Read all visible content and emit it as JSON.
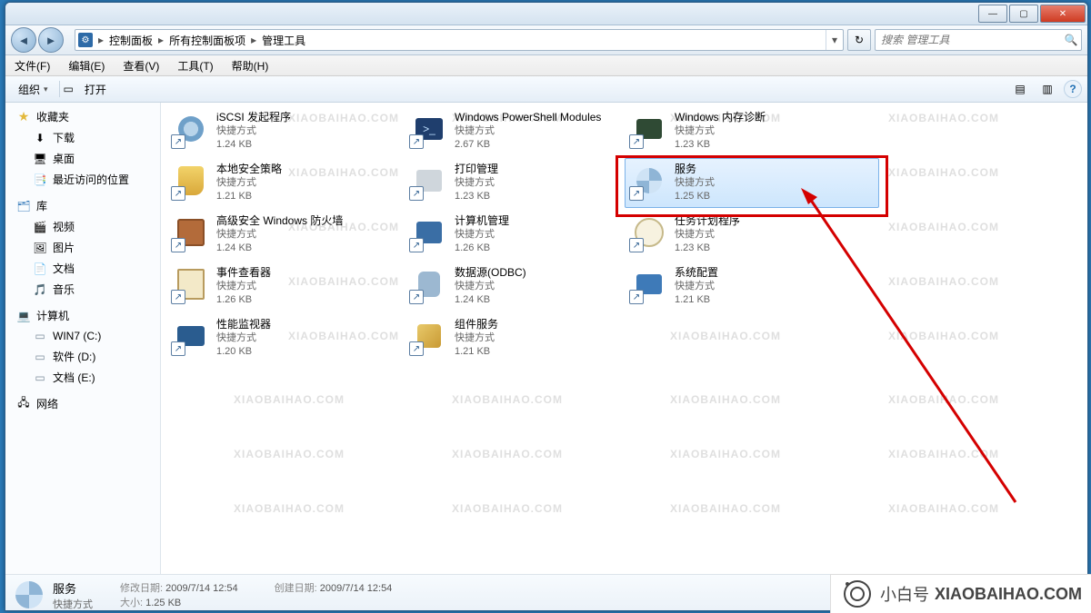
{
  "titlebar": {
    "min": "—",
    "max": "▢",
    "close": "✕"
  },
  "nav": {
    "back": "◄",
    "fwd": "►",
    "crumbs": [
      "控制面板",
      "所有控制面板项",
      "管理工具"
    ],
    "dropdown": "▾",
    "refresh": "↻"
  },
  "search": {
    "placeholder": "搜索 管理工具"
  },
  "menu": {
    "file": "文件(F)",
    "edit": "编辑(E)",
    "view": "查看(V)",
    "tools": "工具(T)",
    "help": "帮助(H)"
  },
  "toolbar": {
    "organize": "组织",
    "open": "打开",
    "drop": "▾",
    "viewIcon": "▤",
    "paneIcon": "▥",
    "helpIcon": "?"
  },
  "sidebar": {
    "favorites": "收藏夹",
    "downloads": "下载",
    "desktop": "桌面",
    "recent": "最近访问的位置",
    "libraries": "库",
    "videos": "视频",
    "pictures": "图片",
    "documents": "文档",
    "music": "音乐",
    "computer": "计算机",
    "drive_c": "WIN7 (C:)",
    "drive_d": "软件 (D:)",
    "drive_e": "文档 (E:)",
    "network": "网络"
  },
  "items": {
    "shortcut": "快捷方式",
    "c1": [
      {
        "name": "iSCSI 发起程序",
        "size": "1.24 KB"
      },
      {
        "name": "本地安全策略",
        "size": "1.21 KB"
      },
      {
        "name": "高级安全 Windows 防火墙",
        "size": "1.24 KB"
      },
      {
        "name": "事件查看器",
        "size": "1.26 KB"
      },
      {
        "name": "性能监视器",
        "size": "1.20 KB"
      }
    ],
    "c2": [
      {
        "name": "Windows PowerShell Modules",
        "size": "2.67 KB"
      },
      {
        "name": "打印管理",
        "size": "1.23 KB"
      },
      {
        "name": "计算机管理",
        "size": "1.26 KB"
      },
      {
        "name": "数据源(ODBC)",
        "size": "1.24 KB"
      },
      {
        "name": "组件服务",
        "size": "1.21 KB"
      }
    ],
    "c3": [
      {
        "name": "Windows 内存诊断",
        "size": "1.23 KB"
      },
      {
        "name": "服务",
        "size": "1.25 KB"
      },
      {
        "name": "任务计划程序",
        "size": "1.23 KB"
      },
      {
        "name": "系统配置",
        "size": "1.21 KB"
      }
    ]
  },
  "details": {
    "name": "服务",
    "type": "快捷方式",
    "modLabel": "修改日期:",
    "modVal": "2009/7/14 12:54",
    "createdLabel": "创建日期:",
    "createdVal": "2009/7/14 12:54",
    "sizeLabel": "大小:",
    "sizeVal": "1.25 KB"
  },
  "brand": {
    "cn": "小白号",
    "en": "XIAOBAIHAO.COM"
  },
  "watermark": "XIAOBAIHAO.COM"
}
